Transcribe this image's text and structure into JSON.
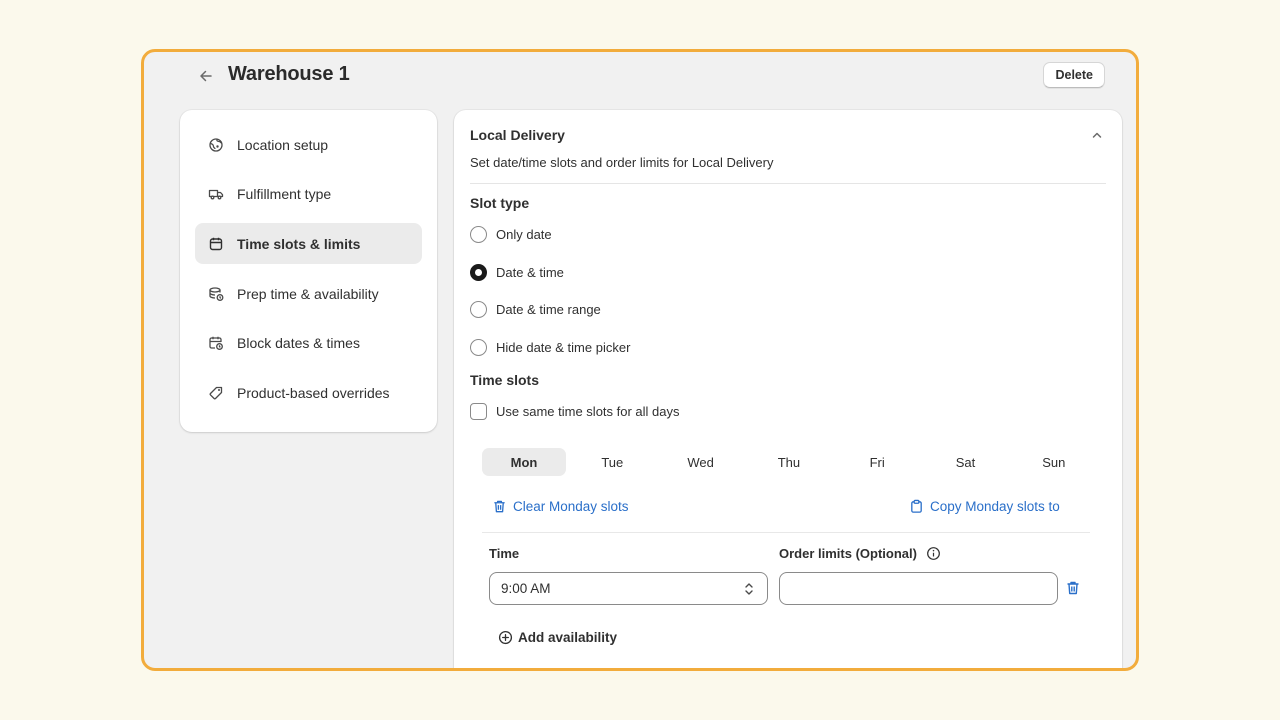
{
  "header": {
    "title": "Warehouse 1",
    "delete_label": "Delete"
  },
  "sidebar": {
    "items": [
      {
        "label": "Location setup",
        "icon": "globe-pin-icon",
        "active": false
      },
      {
        "label": "Fulfillment type",
        "icon": "delivery-truck-icon",
        "active": false
      },
      {
        "label": "Time slots & limits",
        "icon": "calendar-icon",
        "active": true
      },
      {
        "label": "Prep time & availability",
        "icon": "stack-clock-icon",
        "active": false
      },
      {
        "label": "Block dates & times",
        "icon": "calendar-clock-icon",
        "active": false
      },
      {
        "label": "Product-based overrides",
        "icon": "tag-icon",
        "active": false
      }
    ]
  },
  "panel": {
    "title": "Local Delivery",
    "subtitle": "Set date/time slots and order limits for Local Delivery",
    "slot_type_label": "Slot type",
    "slot_types": [
      {
        "label": "Only date",
        "checked": false
      },
      {
        "label": "Date & time",
        "checked": true
      },
      {
        "label": "Date & time range",
        "checked": false
      },
      {
        "label": "Hide date & time picker",
        "checked": false
      }
    ],
    "time_slots_label": "Time slots",
    "same_slots_label": "Use same time slots for all days",
    "same_slots_checked": false,
    "days": [
      "Mon",
      "Tue",
      "Wed",
      "Thu",
      "Fri",
      "Sat",
      "Sun"
    ],
    "active_day": "Mon",
    "clear_label": "Clear Monday slots",
    "copy_label": "Copy Monday slots to",
    "time_label": "Time",
    "limits_label": "Order limits (Optional)",
    "time_value": "9:00 AM",
    "limit_value": "",
    "add_label": "Add availability"
  },
  "colors": {
    "accent_border": "#f2ac3c",
    "link": "#2a6fc9",
    "page_bg": "#fbf9ec"
  }
}
